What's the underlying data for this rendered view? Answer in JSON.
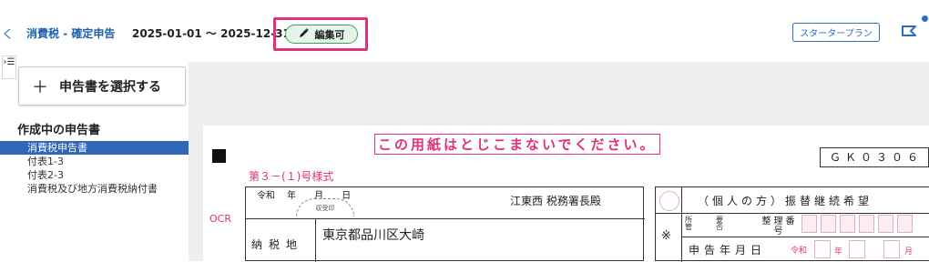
{
  "header": {
    "collapse_glyph": "く",
    "breadcrumb": "消費税 - 確定申告",
    "period": "2025-01-01 〜 2025-12-31",
    "edit_badge": "編集可",
    "plan_button": "スタータープラン",
    "icons": [
      "collapse-icon",
      "pencil-icon",
      "notification-icon"
    ]
  },
  "sidebar": {
    "menu_glyph": "›☰",
    "select_button": "申告書を選択する",
    "section_title": "作成中の申告書",
    "items": [
      {
        "label": "消費税申告書",
        "active": true
      },
      {
        "label": "付表1-3",
        "active": false
      },
      {
        "label": "付表2-3",
        "active": false
      },
      {
        "label": "消費税及び地方消費税納付書",
        "active": false
      }
    ]
  },
  "form": {
    "warning": "この用紙はとじこまないでください。",
    "form_number": "第３－(１)号様式",
    "code": "ＧＫ０３０６",
    "ocr": "OCR",
    "date_header": "令和　 年　　月　　日",
    "stamp": "収受印",
    "office": "江東西 税務署長殿",
    "address_label": "納税地",
    "address": "東京都品川区大崎",
    "transfer": "（個人の方）振替継続希望",
    "kome": "※",
    "seiri": "整理番号",
    "kanri": "所管",
    "yoshi": "要否",
    "shinkoku": "申告年月日",
    "reiwa": "令和",
    "nen": "年",
    "tsuki": "月"
  },
  "colors": {
    "accent": "#2b6cc4",
    "highlight": "#e0317a",
    "badge_bg": "#e6f5ea",
    "badge_border": "#3ca25c"
  }
}
